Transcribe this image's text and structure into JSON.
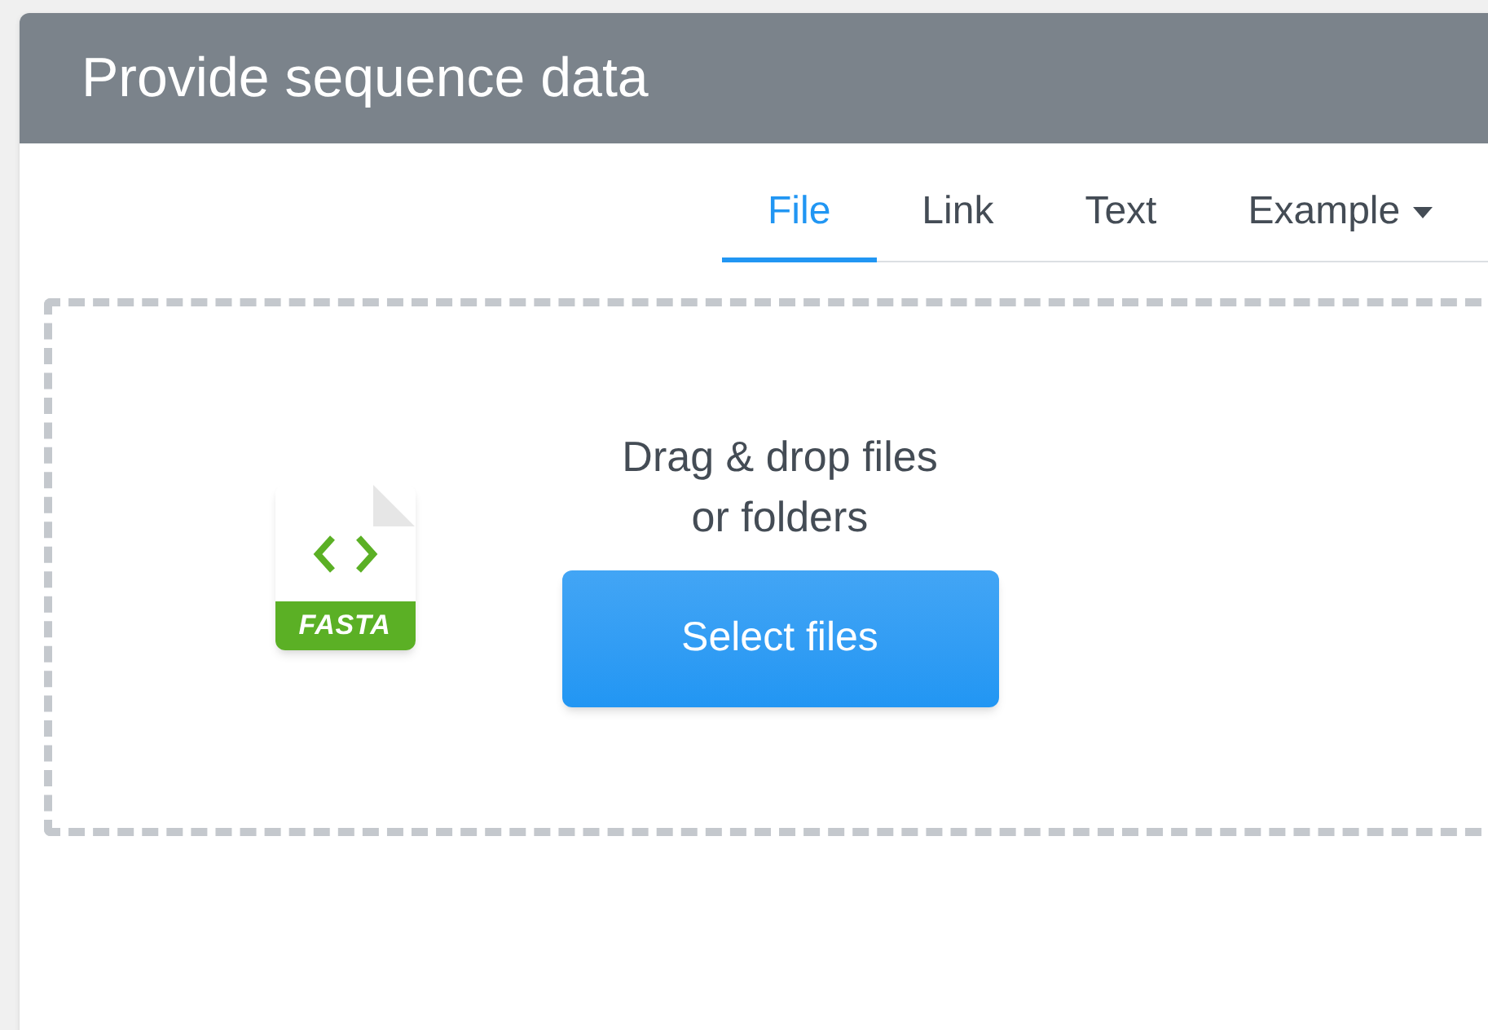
{
  "panel": {
    "title": "Provide sequence data"
  },
  "tabs": [
    {
      "label": "File",
      "selected": true,
      "dropdown": false
    },
    {
      "label": "Link",
      "selected": false,
      "dropdown": false
    },
    {
      "label": "Text",
      "selected": false,
      "dropdown": false
    },
    {
      "label": "Example",
      "selected": false,
      "dropdown": true
    }
  ],
  "dropzone": {
    "file_badge": "FASTA",
    "prompt_lines": [
      "Drag & drop files",
      "or folders"
    ],
    "button": "Select files"
  }
}
